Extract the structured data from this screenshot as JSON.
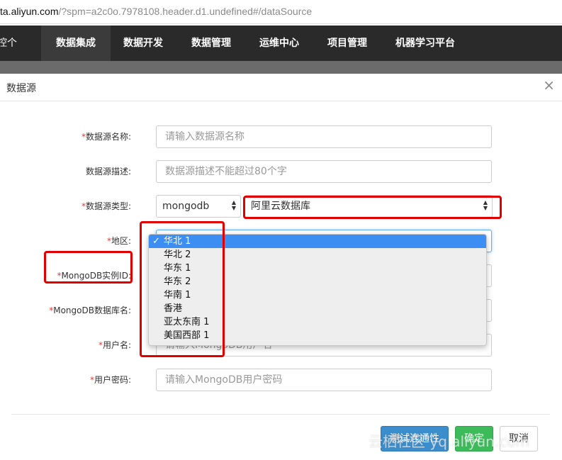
{
  "browser": {
    "url_host": "ta.aliyun.com",
    "url_path": "/?spm=a2c0o.7978108.header.d1.undefined#/dataSource"
  },
  "nav": {
    "left_label": "控个",
    "items": [
      "数据集成",
      "数据开发",
      "数据管理",
      "运维中心",
      "项目管理",
      "机器学习平台"
    ],
    "active_index": 0
  },
  "modal": {
    "title": "数据源",
    "close": "×"
  },
  "form": {
    "name": {
      "label": "数据源名称:",
      "required": "*",
      "placeholder": "请输入数据源名称"
    },
    "desc": {
      "label": "数据源描述:",
      "placeholder": "数据源描述不能超过80个字"
    },
    "type": {
      "label": "数据源类型:",
      "required": "*",
      "db_value": "mongodb",
      "instance_type_value": "阿里云数据库"
    },
    "region": {
      "label": "地区:",
      "required": "*"
    },
    "instance_id": {
      "label": "MongoDB实例ID:",
      "required": "*"
    },
    "db_name": {
      "label": "MongoDB数据库名:",
      "required": "*"
    },
    "username": {
      "label": "用户名:",
      "required": "*",
      "placeholder": "请输入MongoDB用户名"
    },
    "password": {
      "label": "用户密码:",
      "required": "*",
      "placeholder": "请输入MongoDB用户密码"
    }
  },
  "region_dropdown": {
    "check": "✓",
    "options": [
      "华北 1",
      "华北 2",
      "华东 1",
      "华东 2",
      "华南 1",
      "香港",
      "亚太东南 1",
      "美国西部 1"
    ],
    "selected_index": 0
  },
  "buttons": {
    "test": "测试连通性",
    "ok": "确定",
    "cancel": "取消"
  },
  "watermark": "云栖社区 yq.aliyun.com",
  "colors": {
    "nav_bg": "#2a2a2a",
    "highlight_red": "#e00000",
    "selected_option": "#3d8ef2",
    "btn_primary": "#3c8dcb",
    "btn_success": "#3dbb5a"
  }
}
